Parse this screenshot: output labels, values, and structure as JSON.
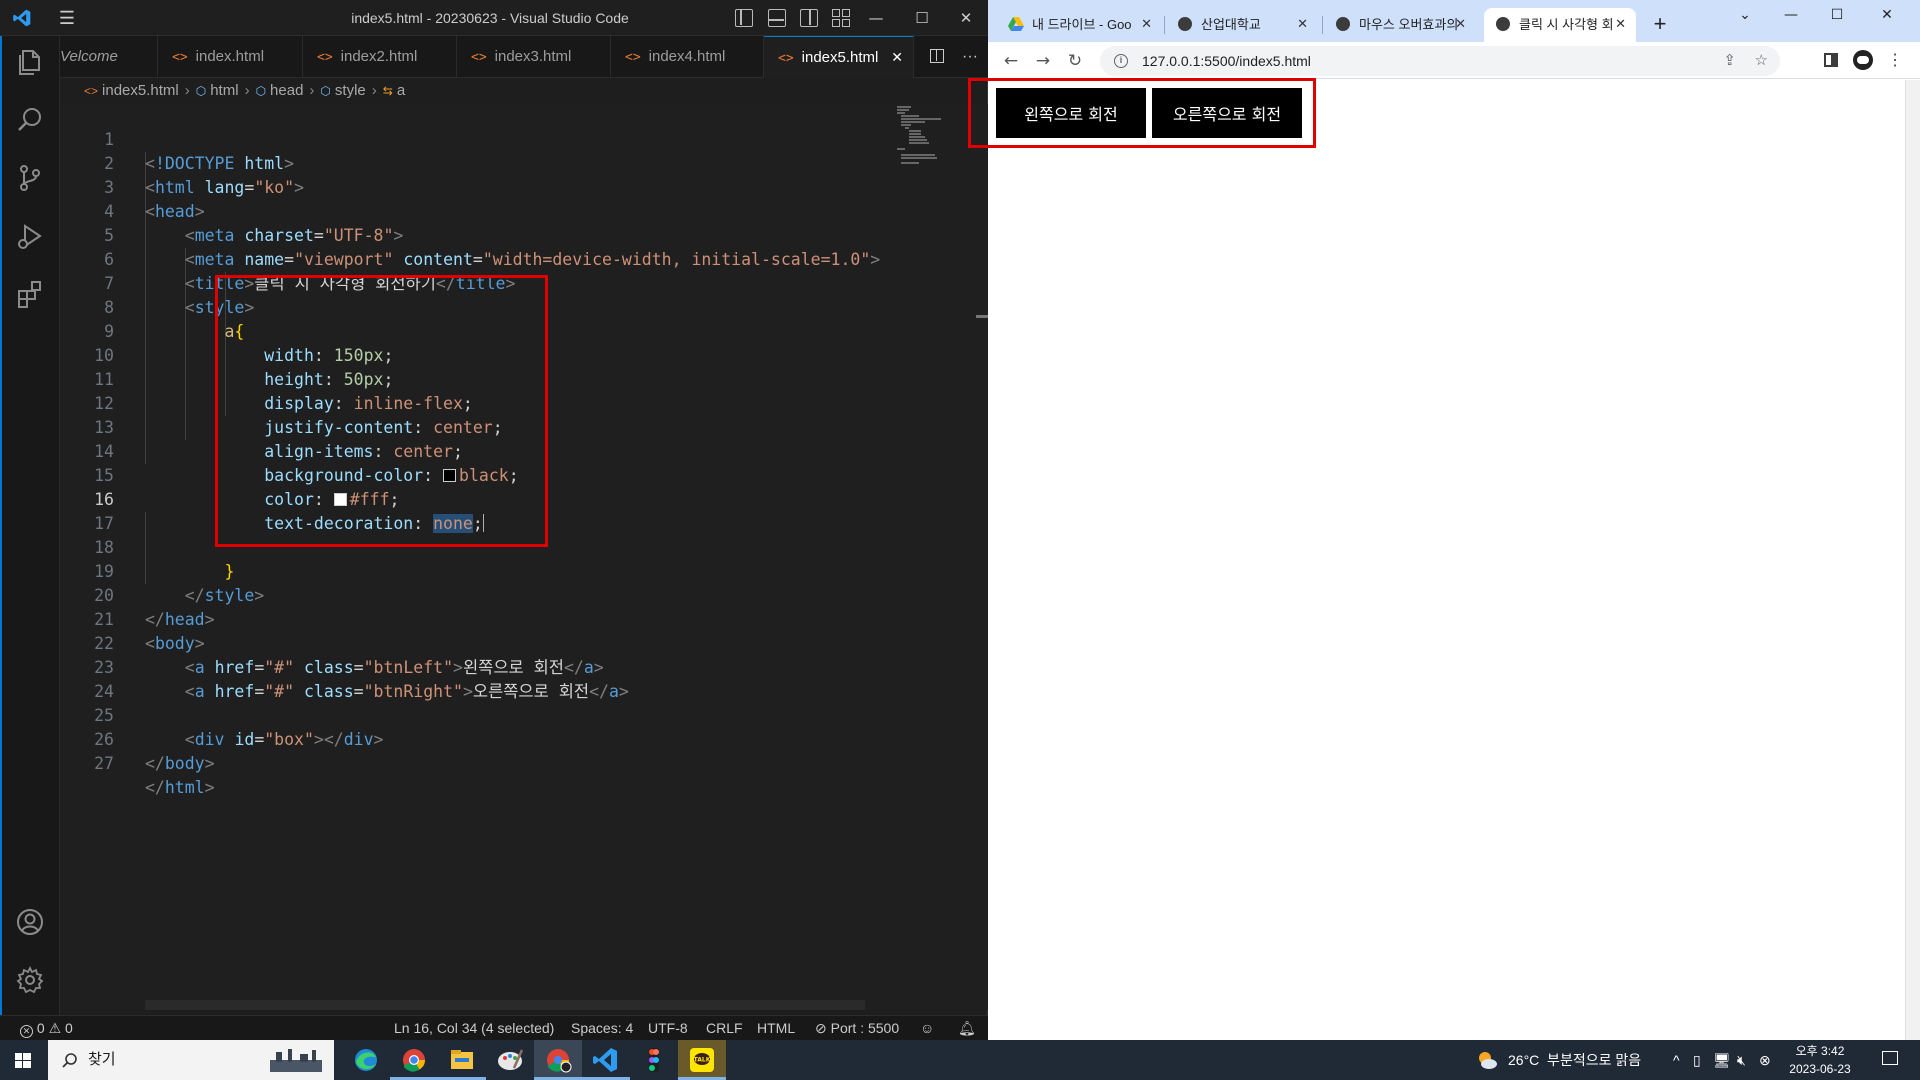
{
  "vscode": {
    "window_title": "index5.html - 20230623 - Visual Studio Code",
    "tabs": [
      {
        "label": "Velcome"
      },
      {
        "label": "index.html"
      },
      {
        "label": "index2.html"
      },
      {
        "label": "index3.html"
      },
      {
        "label": "index4.html"
      },
      {
        "label": "index5.html",
        "active": true
      }
    ],
    "breadcrumb": [
      "index5.html",
      "html",
      "head",
      "style",
      "a"
    ],
    "code_lines": [
      {
        "n": "1"
      },
      {
        "n": "2"
      },
      {
        "n": "3"
      },
      {
        "n": "4"
      },
      {
        "n": "5"
      },
      {
        "n": "6"
      },
      {
        "n": "7"
      },
      {
        "n": "8"
      },
      {
        "n": "9"
      },
      {
        "n": "10"
      },
      {
        "n": "11"
      },
      {
        "n": "12"
      },
      {
        "n": "13"
      },
      {
        "n": "14"
      },
      {
        "n": "15"
      },
      {
        "n": "16"
      },
      {
        "n": "17"
      },
      {
        "n": "18"
      },
      {
        "n": "19"
      },
      {
        "n": "20"
      },
      {
        "n": "21"
      },
      {
        "n": "22"
      },
      {
        "n": "23"
      },
      {
        "n": "24"
      },
      {
        "n": "25"
      },
      {
        "n": "26"
      },
      {
        "n": "27"
      }
    ],
    "code": {
      "l1_doctype": "!DOCTYPE",
      "l1_html": "html",
      "l2_html": "html",
      "l2_attr": "lang",
      "l2_val": "\"ko\"",
      "l3_head": "head",
      "l4_meta": "meta",
      "l4_attr": "charset",
      "l4_val": "\"UTF-8\"",
      "l5_meta": "meta",
      "l5_attr1": "name",
      "l5_val1": "\"viewport\"",
      "l5_attr2": "content",
      "l5_val2": "\"width=device-width, initial-scale=1.0\"",
      "l6_title": "title",
      "l6_text": "클릭 시 사각형 회전하기",
      "l7_style": "style",
      "l8_sel": "a",
      "l9_prop": "width",
      "l9_val": "150px",
      "l10_prop": "height",
      "l10_val": "50px",
      "l11_prop": "display",
      "l11_val": "inline-flex",
      "l12_prop": "justify-content",
      "l12_val": "center",
      "l13_prop": "align-items",
      "l13_val": "center",
      "l14_prop": "background-color",
      "l14_val": "black",
      "l15_prop": "color",
      "l15_val": "#fff",
      "l16_prop": "text-decoration",
      "l16_val": "none",
      "l19_style": "style",
      "l20_head": "head",
      "l21_body": "body",
      "l22_a": "a",
      "l22_attr1": "href",
      "l22_val1": "\"#\"",
      "l22_attr2": "class",
      "l22_val2": "\"btnLeft\"",
      "l22_text": "왼쪽으로 회전",
      "l23_a": "a",
      "l23_attr1": "href",
      "l23_val1": "\"#\"",
      "l23_attr2": "class",
      "l23_val2": "\"btnRight\"",
      "l23_text": "오른쪽으로 회전",
      "l25_div": "div",
      "l25_attr": "id",
      "l25_val": "\"box\"",
      "l26_body": "body",
      "l27_html": "html"
    },
    "status": {
      "errors": "0",
      "warnings": "0",
      "cursor": "Ln 16, Col 34 (4 selected)",
      "spaces": "Spaces: 4",
      "encoding": "UTF-8",
      "eol": "CRLF",
      "language": "HTML",
      "port": "Port : 5500"
    },
    "current_line": "16",
    "highlight_color": "#e00000"
  },
  "chrome": {
    "tabs": [
      {
        "label": "내 드라이브 - Goo"
      },
      {
        "label": "산업대학교"
      },
      {
        "label": "마우스 오버효과의"
      },
      {
        "label": "클릭 시 사각형 회"
      }
    ],
    "url": "127.0.0.1:5500/index5.html",
    "page": {
      "btn_left": "왼쪽으로 회전",
      "btn_right": "오른쪽으로 회전"
    }
  },
  "taskbar": {
    "search_placeholder": "찾기",
    "weather": "26°C  부분적으로 맑음",
    "time": "오후 3:42",
    "date": "2023-06-23",
    "apps": [
      "edge-icon",
      "chrome-icon",
      "file-explorer-icon",
      "paint-icon",
      "chrome-profile-icon",
      "vscode-icon",
      "figma-icon",
      "kakaotalk-icon"
    ]
  }
}
